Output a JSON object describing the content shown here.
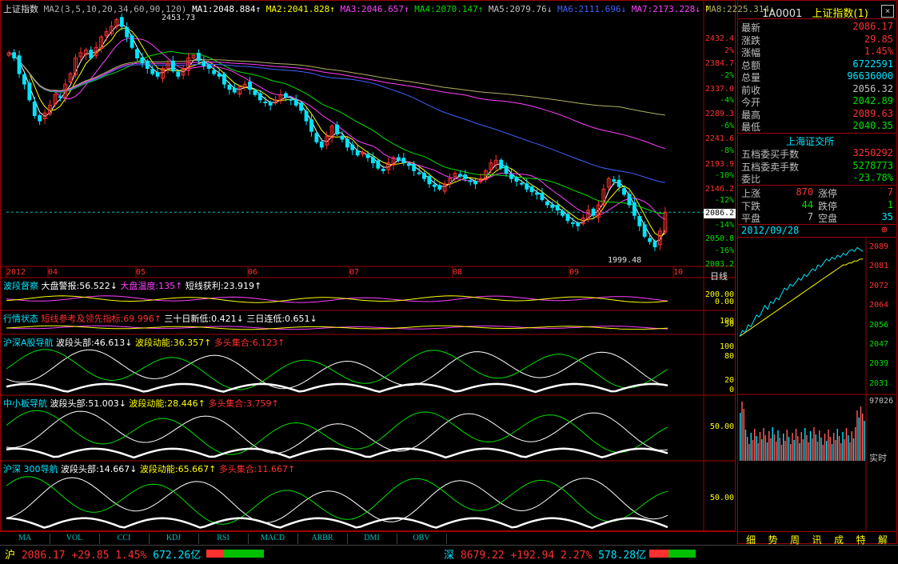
{
  "main_header": {
    "name": "上证指数",
    "ma_params": "MA2(3,5,10,20,34,60,90,120)",
    "ma_values": [
      {
        "label": "MA1:2048.884",
        "arrow": "↑",
        "color": "#ffffff"
      },
      {
        "label": "MA2:2041.828",
        "arrow": "↑",
        "color": "#ffff00"
      },
      {
        "label": "MA3:2046.657",
        "arrow": "↑",
        "color": "#ff40ff"
      },
      {
        "label": "MA4:2070.147",
        "arrow": "↑",
        "color": "#00e000"
      },
      {
        "label": "MA5:2079.76",
        "arrow": "↓",
        "color": "#c0c0c0"
      },
      {
        "label": "MA6:2111.696",
        "arrow": "↓",
        "color": "#4060ff"
      },
      {
        "label": "MA7:2173.228",
        "arrow": "↓",
        "color": "#ff40ff"
      },
      {
        "label": "MA8:2225.314",
        "arrow": "↓",
        "color": "#b0b060"
      }
    ]
  },
  "price_axis": {
    "prices": [
      "2432.4",
      "2384.7",
      "2337.0",
      "2289.3",
      "2241.6",
      "2193.9",
      "2146.2",
      "2098.5",
      "2050.8",
      "2003.2"
    ],
    "percents": [
      "2%",
      "-2%",
      "-4%",
      "-6%",
      "-8%",
      "-10%",
      "-12%",
      "-14%",
      "-16%"
    ],
    "current_tag": "2086.2"
  },
  "annotations": {
    "high": "2453.73",
    "low": "1999.48"
  },
  "date_axis": [
    "2012",
    "04",
    "05",
    "06",
    "07",
    "08",
    "09",
    "10"
  ],
  "period_label": "日线",
  "indicator_panels": [
    {
      "title": "波段督察",
      "items": [
        {
          "text": "大盘警报:56.522",
          "arrow": "↓",
          "color": "#ffffff"
        },
        {
          "text": "大盘温度:135",
          "arrow": "↑",
          "color": "#ff40ff"
        },
        {
          "text": "短线获利:23.919",
          "arrow": "↑",
          "color": "#ffffff"
        }
      ],
      "axis": [
        "200.00",
        "0.00"
      ]
    },
    {
      "title": "行情状态",
      "items": [
        {
          "text": "短线参考及领先指标:69.996",
          "arrow": "↑",
          "color": "#ff3030"
        },
        {
          "text": "三十日新低:0.421",
          "arrow": "↓",
          "color": "#ffffff"
        },
        {
          "text": "三日连低:0.651",
          "arrow": "↓",
          "color": "#ffffff"
        }
      ],
      "axis": [
        "100",
        "50"
      ]
    },
    {
      "title": "沪深A股导航",
      "items": [
        {
          "text": "波段头部:46.613",
          "arrow": "↓",
          "color": "#ffffff"
        },
        {
          "text": "波段动能:36.357",
          "arrow": "↑",
          "color": "#ffff00"
        },
        {
          "text": "多头集合:6.123",
          "arrow": "↑",
          "color": "#ff3030"
        }
      ],
      "axis": [
        "100",
        "80",
        "20",
        "0"
      ]
    },
    {
      "title": "中小板导航",
      "items": [
        {
          "text": "波段头部:51.003",
          "arrow": "↓",
          "color": "#ffffff"
        },
        {
          "text": "波段动能:28.446",
          "arrow": "↑",
          "color": "#ffff00"
        },
        {
          "text": "多头集合:3.759",
          "arrow": "↑",
          "color": "#ff3030"
        }
      ],
      "axis": [
        "50.00"
      ]
    },
    {
      "title": "沪深 300导航",
      "items": [
        {
          "text": "波段头部:14.667",
          "arrow": "↓",
          "color": "#ffffff"
        },
        {
          "text": "波段动能:65.667",
          "arrow": "↑",
          "color": "#ffff00"
        },
        {
          "text": "多头集合:11.667",
          "arrow": "↑",
          "color": "#ff3030"
        }
      ],
      "axis": [
        "50.00"
      ]
    }
  ],
  "bottom_tabs": [
    "MA",
    "VOL",
    "CCI",
    "KDJ",
    "RSI",
    "MACD",
    "ARBR",
    "DMI",
    "OBV"
  ],
  "quote": {
    "code": "1A0001",
    "name": "上证指数(1)",
    "rows": [
      {
        "k": "最新",
        "v": "2086.17",
        "color": "#ff3030"
      },
      {
        "k": "涨跌",
        "v": "29.85",
        "color": "#ff3030"
      },
      {
        "k": "涨幅",
        "v": "1.45%",
        "color": "#ff3030"
      },
      {
        "k": "总额",
        "v": "6722591",
        "color": "#00e5ff"
      },
      {
        "k": "总量",
        "v": "96636000",
        "color": "#00e5ff"
      },
      {
        "k": "前收",
        "v": "2056.32",
        "color": "#c0c0c0"
      },
      {
        "k": "今开",
        "v": "2042.89",
        "color": "#00e000"
      },
      {
        "k": "最高",
        "v": "2089.63",
        "color": "#ff3030"
      },
      {
        "k": "最低",
        "v": "2040.35",
        "color": "#00e000"
      }
    ],
    "exchange": "上海证交所",
    "order_rows": [
      {
        "k": "五档委买手数",
        "v": "3250292",
        "color": "#ff3030"
      },
      {
        "k": "五档委卖手数",
        "v": "5278773",
        "color": "#00e000"
      },
      {
        "k": "委比",
        "v": "-23.78%",
        "color": "#00e000"
      }
    ],
    "breadth": [
      {
        "k1": "上涨",
        "v1": "870",
        "c1": "#ff3030",
        "k2": "涨停",
        "v2": "7",
        "c2": "#ff3030"
      },
      {
        "k1": "下跌",
        "v1": "44",
        "c1": "#00e000",
        "k2": "跌停",
        "v2": "1",
        "c2": "#00e000"
      },
      {
        "k1": "平盘",
        "v1": "7",
        "c1": "#c0c0c0",
        "k2": "空盘",
        "v2": "35",
        "c2": "#00e5ff"
      }
    ],
    "date": "2012/09/28"
  },
  "intraday": {
    "price_axis": [
      "2089",
      "2081",
      "2072",
      "2064",
      "2056",
      "2047",
      "2039",
      "2031"
    ],
    "vol_label": "97026",
    "realtime": "实时"
  },
  "right_tabs": [
    "细",
    "势",
    "周",
    "讯",
    "成",
    "特",
    "解"
  ],
  "status_bar": {
    "sh": {
      "name": "沪",
      "price": "2086.17",
      "chg": "+29.85",
      "pct": "1.45%",
      "amt": "672.26亿"
    },
    "sz": {
      "name": "深",
      "price": "8679.22",
      "chg": "+192.94",
      "pct": "2.27%",
      "amt": "578.28亿"
    }
  },
  "colors": {
    "up": "#ff3030",
    "down": "#00e5ff",
    "grid": "#a00000",
    "bg": "#000000"
  },
  "chart_data": [
    {
      "type": "candlestick",
      "title": "上证指数",
      "period": "日线",
      "x_labels": [
        "2012",
        "04",
        "05",
        "06",
        "07",
        "08",
        "09",
        "10"
      ],
      "ylim": [
        1999.48,
        2453.73
      ],
      "closes": [
        2390,
        2380,
        2350,
        2330,
        2300,
        2270,
        2260,
        2275,
        2290,
        2310,
        2305,
        2330,
        2350,
        2380,
        2390,
        2395,
        2380,
        2400,
        2420,
        2430,
        2440,
        2453,
        2440,
        2420,
        2400,
        2380,
        2370,
        2360,
        2350,
        2345,
        2360,
        2370,
        2355,
        2345,
        2360,
        2380,
        2385,
        2375,
        2365,
        2360,
        2350,
        2345,
        2330,
        2320,
        2315,
        2325,
        2330,
        2320,
        2310,
        2300,
        2295,
        2290,
        2300,
        2310,
        2305,
        2300,
        2290,
        2280,
        2260,
        2240,
        2220,
        2210,
        2230,
        2250,
        2235,
        2225,
        2210,
        2205,
        2195,
        2200,
        2190,
        2180,
        2170,
        2165,
        2180,
        2190,
        2185,
        2180,
        2175,
        2165,
        2160,
        2150,
        2140,
        2135,
        2130,
        2140,
        2150,
        2160,
        2155,
        2150,
        2145,
        2140,
        2150,
        2165,
        2180,
        2185,
        2170,
        2160,
        2150,
        2145,
        2140,
        2130,
        2125,
        2120,
        2110,
        2100,
        2095,
        2090,
        2080,
        2070,
        2065,
        2060,
        2075,
        2090,
        2080,
        2100,
        2130,
        2150,
        2145,
        2135,
        2120,
        2100,
        2080,
        2060,
        2040,
        2030,
        2020,
        2050,
        2086
      ],
      "series": [
        {
          "name": "MA1:2048.884",
          "color": "#ffffff"
        },
        {
          "name": "MA2:2041.828",
          "color": "#ffff00"
        },
        {
          "name": "MA3:2046.657",
          "color": "#ff40ff"
        },
        {
          "name": "MA4:2070.147",
          "color": "#00e000"
        },
        {
          "name": "MA6:2111.696",
          "color": "#4060ff"
        },
        {
          "name": "MA7:2173.228",
          "color": "#ff40ff"
        },
        {
          "name": "MA8:2225.314",
          "color": "#b0b060"
        }
      ]
    },
    {
      "type": "line",
      "title": "intraday",
      "ylim": [
        2031,
        2089
      ],
      "prices": [
        2042,
        2045,
        2044,
        2048,
        2047,
        2050,
        2053,
        2052,
        2055,
        2058,
        2056,
        2060,
        2059,
        2062,
        2061,
        2064,
        2067,
        2066,
        2069,
        2068,
        2070,
        2072,
        2071,
        2074,
        2073,
        2075,
        2077,
        2076,
        2079,
        2078,
        2080,
        2082,
        2081,
        2083,
        2082,
        2084,
        2083,
        2085,
        2084,
        2086,
        2087,
        2086,
        2088,
        2087,
        2086
      ],
      "avg": [
        2042,
        2043,
        2044,
        2045,
        2046,
        2047,
        2048,
        2049,
        2050,
        2051,
        2052,
        2053,
        2054,
        2055,
        2056,
        2057,
        2058,
        2059,
        2060,
        2061,
        2062,
        2063,
        2064,
        2065,
        2066,
        2067,
        2068,
        2069,
        2070,
        2071,
        2072,
        2073,
        2074,
        2075,
        2076,
        2077,
        2078,
        2079,
        2079,
        2080,
        2080,
        2081,
        2081,
        2082,
        2082
      ]
    }
  ]
}
